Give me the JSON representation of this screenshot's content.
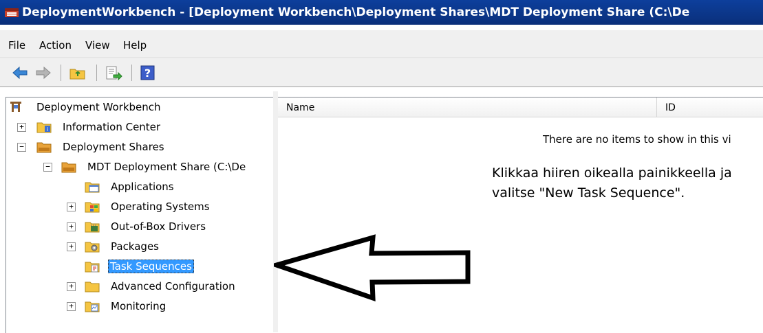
{
  "window": {
    "title": "DeploymentWorkbench - [Deployment Workbench\\Deployment Shares\\MDT Deployment Share (C:\\De"
  },
  "menu": {
    "file": "File",
    "action": "Action",
    "view": "View",
    "help": "Help"
  },
  "toolbar": {
    "icons": [
      "back-arrow-icon",
      "forward-arrow-icon",
      "up-folder-icon",
      "export-list-icon",
      "help-icon"
    ]
  },
  "tree": {
    "root": "Deployment Workbench",
    "info_center": "Information Center",
    "deployment_shares": "Deployment Shares",
    "mdt_share": "MDT Deployment Share (C:\\De",
    "applications": "Applications",
    "operating_systems": "Operating Systems",
    "drivers": "Out-of-Box Drivers",
    "packages": "Packages",
    "task_sequences": "Task Sequences",
    "advanced": "Advanced Configuration",
    "monitoring": "Monitoring"
  },
  "list": {
    "columns": [
      "Name",
      "ID"
    ],
    "empty_text": "There are no items to show in this vi"
  },
  "annotation": {
    "text": "Klikkaa hiiren oikealla painikkeella ja valitse \"New Task Sequence\"."
  },
  "colors": {
    "titlebar": "#0d3f9c",
    "selection": "#3399ff",
    "folder": "#f5c542"
  }
}
